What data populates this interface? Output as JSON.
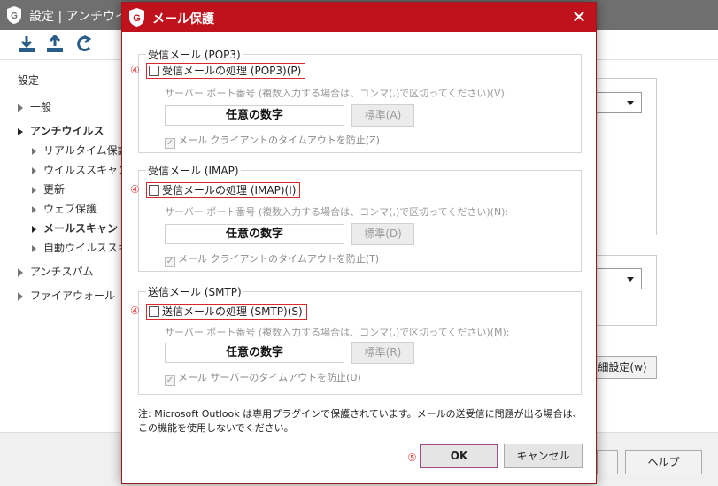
{
  "background": {
    "window_title": "設定 | アンチウイル",
    "nav": {
      "settings": "設定",
      "general": "一般",
      "antivirus": "アンチウイルス",
      "realtime": "リアルタイム保護",
      "virusscan": "ウイルススキャン",
      "update": "更新",
      "webprotect": "ウェブ保護",
      "mailscan": "メールスキャン",
      "autoscan": "自動ウイルススキャ",
      "antispam": "アンチスパム",
      "firewall": "ファイアウォール"
    },
    "advanced_button": "細設定(w)",
    "help_button": "ヘルプ"
  },
  "dialog": {
    "title": "メール保護",
    "pop3": {
      "legend": "受信メール (POP3)",
      "marker": "④",
      "checkbox_label": "受信メールの処理 (POP3)(P)",
      "port_label": "サーバー ポート番号 (複数入力する場合は、コンマ(,)で区切ってください)(V):",
      "port_value": "任意の数字",
      "std_button": "標準(A)",
      "timeout_label": "メール クライアントのタイムアウトを防止(Z)"
    },
    "imap": {
      "legend": "受信メール (IMAP)",
      "marker": "④",
      "checkbox_label": "受信メールの処理 (IMAP)(I)",
      "port_label": "サーバー ポート番号 (複数入力する場合は、コンマ(,)で区切ってください)(N):",
      "port_value": "任意の数字",
      "std_button": "標準(D)",
      "timeout_label": "メール クライアントのタイムアウトを防止(T)"
    },
    "smtp": {
      "legend": "送信メール (SMTP)",
      "marker": "④",
      "checkbox_label": "送信メールの処理 (SMTP)(S)",
      "port_label": "サーバー ポート番号 (複数入力する場合は、コンマ(,)で区切ってください)(M):",
      "port_value": "任意の数字",
      "std_button": "標準(R)",
      "timeout_label": "メール サーバーのタイムアウトを防止(U)"
    },
    "note": "注: Microsoft Outlook は専用プラグインで保護されています。メールの送受信に問題が出る場合は、この機能を使用しないでください。",
    "marker_ok": "⑤",
    "ok_button": "OK",
    "cancel_button": "キャンセル"
  },
  "colors": {
    "accent_red": "#c0121c",
    "marker_red": "#e03030",
    "ok_border": "#a04a8e"
  }
}
